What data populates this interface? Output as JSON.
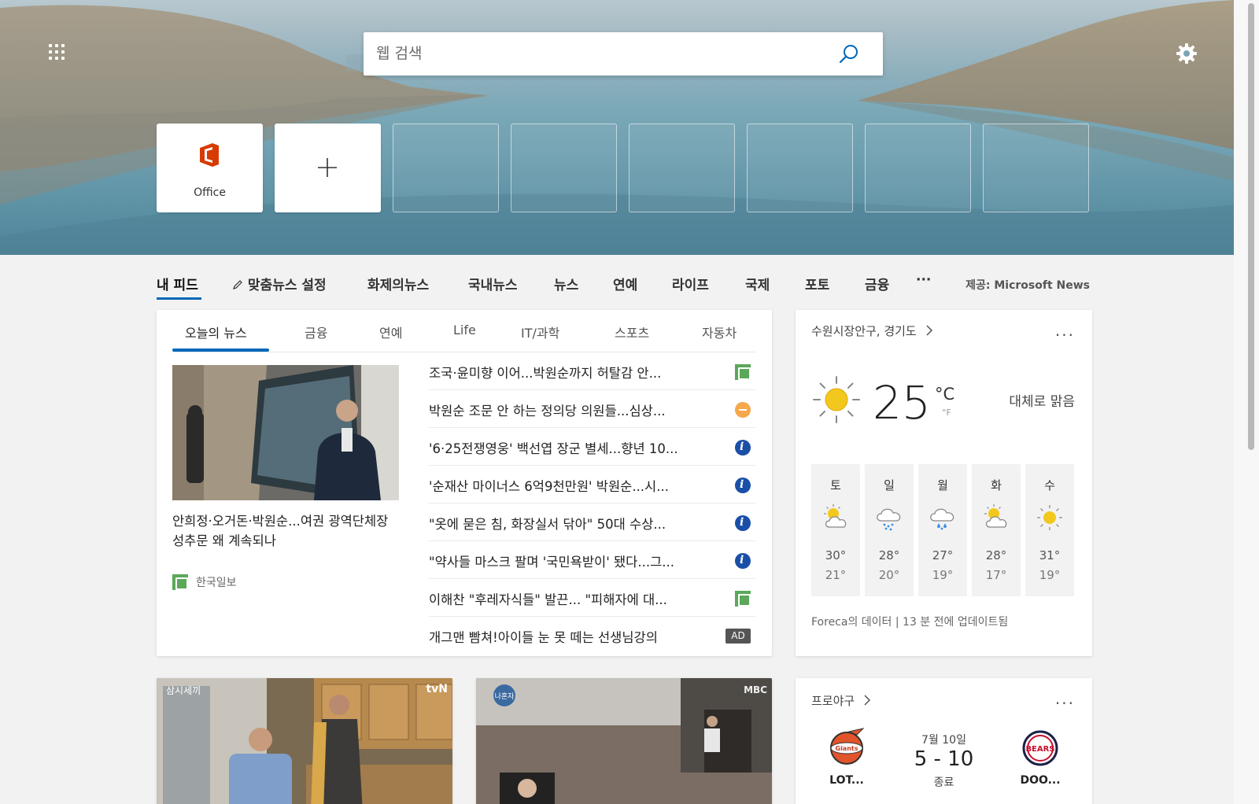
{
  "search": {
    "placeholder": "웹 검색"
  },
  "tiles": [
    {
      "label": "Office"
    },
    {
      "label": ""
    }
  ],
  "nav": {
    "items": [
      "내 피드",
      "맞춤뉴스 설정",
      "화제의뉴스",
      "국내뉴스",
      "뉴스",
      "연예",
      "라이프",
      "국제",
      "포토",
      "금융",
      "···"
    ],
    "provider": "제공: Microsoft News"
  },
  "news": {
    "tabs": [
      "오늘의 뉴스",
      "금융",
      "연예",
      "Life",
      "IT/과학",
      "스포츠",
      "자동차"
    ],
    "feature": {
      "title": "안희정·오거돈·박원순...여권 광역단체장 성추문 왜 계속되나",
      "source": "한국일보"
    },
    "headlines": [
      {
        "text": "조국·윤미향 이어...박원순까지 허탈감 안...",
        "publisher": "hankook"
      },
      {
        "text": "박원순 조문 안 하는 정의당 의원들...심상...",
        "publisher": "orange"
      },
      {
        "text": "'6·25전쟁영웅' 백선엽 장군 별세...향년 10...",
        "publisher": "blue"
      },
      {
        "text": "'순재산 마이너스 6억9천만원' 박원순...시...",
        "publisher": "blue"
      },
      {
        "text": "\"옷에 묻은 침, 화장실서 닦아\" 50대 수상...",
        "publisher": "blue"
      },
      {
        "text": "\"약사들 마스크 팔며 '국민욕받이' 됐다...그...",
        "publisher": "blue"
      },
      {
        "text": "이해찬 \"후레자식들\" 발끈... \"피해자에 대...",
        "publisher": "hankook"
      },
      {
        "text": "개그맨 빰쳐!아이들 눈 못 떼는 선생님강의",
        "publisher": "ad"
      }
    ],
    "ad_label": "AD"
  },
  "weather": {
    "location": "수원시장안구, 경기도",
    "temp": "25",
    "unit_c": "°C",
    "unit_f": "°F",
    "condition": "대체로 맑음",
    "days": [
      {
        "name": "토",
        "icon": "partly-sunny-icon",
        "hi": "30°",
        "lo": "21°"
      },
      {
        "name": "일",
        "icon": "rain-icon",
        "hi": "28°",
        "lo": "20°"
      },
      {
        "name": "월",
        "icon": "rain-icon",
        "hi": "27°",
        "lo": "19°"
      },
      {
        "name": "화",
        "icon": "partly-sunny-icon",
        "hi": "28°",
        "lo": "17°"
      },
      {
        "name": "수",
        "icon": "sunny-icon",
        "hi": "31°",
        "lo": "19°"
      }
    ],
    "footer": "Foreca의 데이터 | 13 분 전에 업데이트됨"
  },
  "baseball": {
    "title": "프로야구",
    "date": "7월 10일",
    "score": "5  -  10",
    "status": "종료",
    "home": {
      "name": "LOT...",
      "logo_text": "Giants"
    },
    "away": {
      "name": "DOO...",
      "logo_text": "BEARS"
    }
  },
  "cards": {
    "tvn_logo": "tvN",
    "mbc_logo": "MBC"
  },
  "colors": {
    "accent": "#0067b8",
    "office": "#d83b01"
  }
}
